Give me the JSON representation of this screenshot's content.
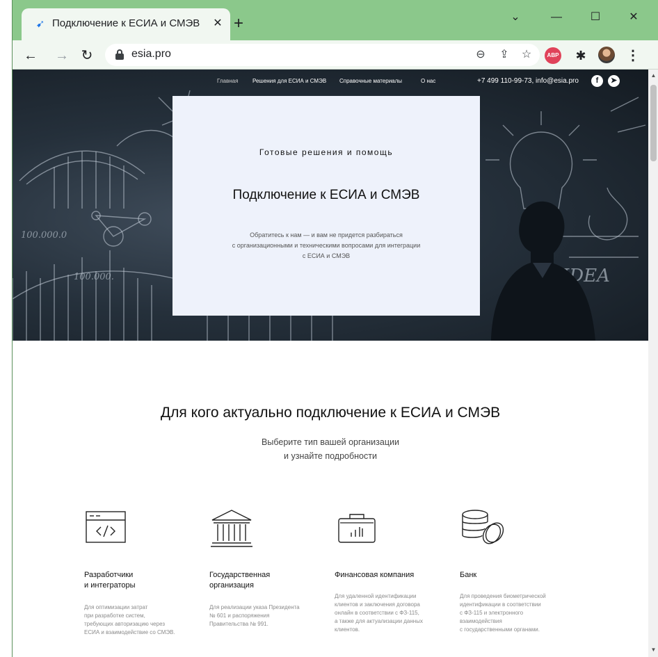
{
  "browser": {
    "tab_title": "Подключение к ЕСИА и СМЭВ",
    "tab_close": "✕",
    "new_tab": "+",
    "window_controls": {
      "minimize": "—",
      "maximize": "☐",
      "close": "✕",
      "tab_search": "⌄"
    },
    "nav": {
      "back": "←",
      "forward": "→",
      "reload": "↻"
    },
    "url": "esia.pro",
    "omnibox_icons": {
      "zoom": "⊖",
      "share": "⇪",
      "bookmark": "☆"
    },
    "abp_label": "ABP",
    "extensions_glyph": "✱",
    "menu_glyph": "⋮",
    "accent_color": "#8bc88b"
  },
  "site": {
    "nav": {
      "items": [
        {
          "label": "Главная"
        },
        {
          "label": "Решения для ЕСИА и СМЭВ"
        },
        {
          "label": "Справочные материалы"
        },
        {
          "label": "О нас"
        }
      ],
      "contact": "+7 499 110-99-73, info@esia.pro",
      "social": {
        "facebook": "f",
        "telegram": "➤"
      }
    },
    "hero": {
      "kicker": "Готовые решения и помощь",
      "title": "Подключение к ЕСИА и СМЭВ",
      "description": "Обратитесь к нам — и вам не придется разбираться\nс организационными и техническими вопросами для интеграции\nс ЕСИА и СМЭВ",
      "chalk_texts": [
        "100.000.0",
        "100.000.",
        "IDEA"
      ]
    },
    "section": {
      "title": "Для кого актуально подключение к ЕСИА и СМЭВ",
      "subtitle": "Выберите тип вашей организации\nи узнайте подробности"
    },
    "orgs": [
      {
        "icon": "code-window-icon",
        "title": "Разработчики\nи интеграторы",
        "description": "Для оптимизации затрат\nпри разработке систем,\nтребующих авторизацию через\nЕСИА и взаимодействие со СМЭВ."
      },
      {
        "icon": "government-building-icon",
        "title": "Государственная\nорганизация",
        "description": "Для реализации указа Президента\n№ 601 и распоряжения\nПравительства № 991."
      },
      {
        "icon": "briefcase-chart-icon",
        "title": "Финансовая компания",
        "description": "Для удаленной идентификации\nклиентов и заключения договора\nонлайн в соответствии с ФЗ-115,\nа также для актуализации данных\nклиентов."
      },
      {
        "icon": "coins-stack-icon",
        "title": "Банк",
        "description": "Для проведения биометрической\nидентификации в соответствии\nс ФЗ-115 и электронного\nвзаимодействия\nс государственными органами."
      }
    ]
  }
}
